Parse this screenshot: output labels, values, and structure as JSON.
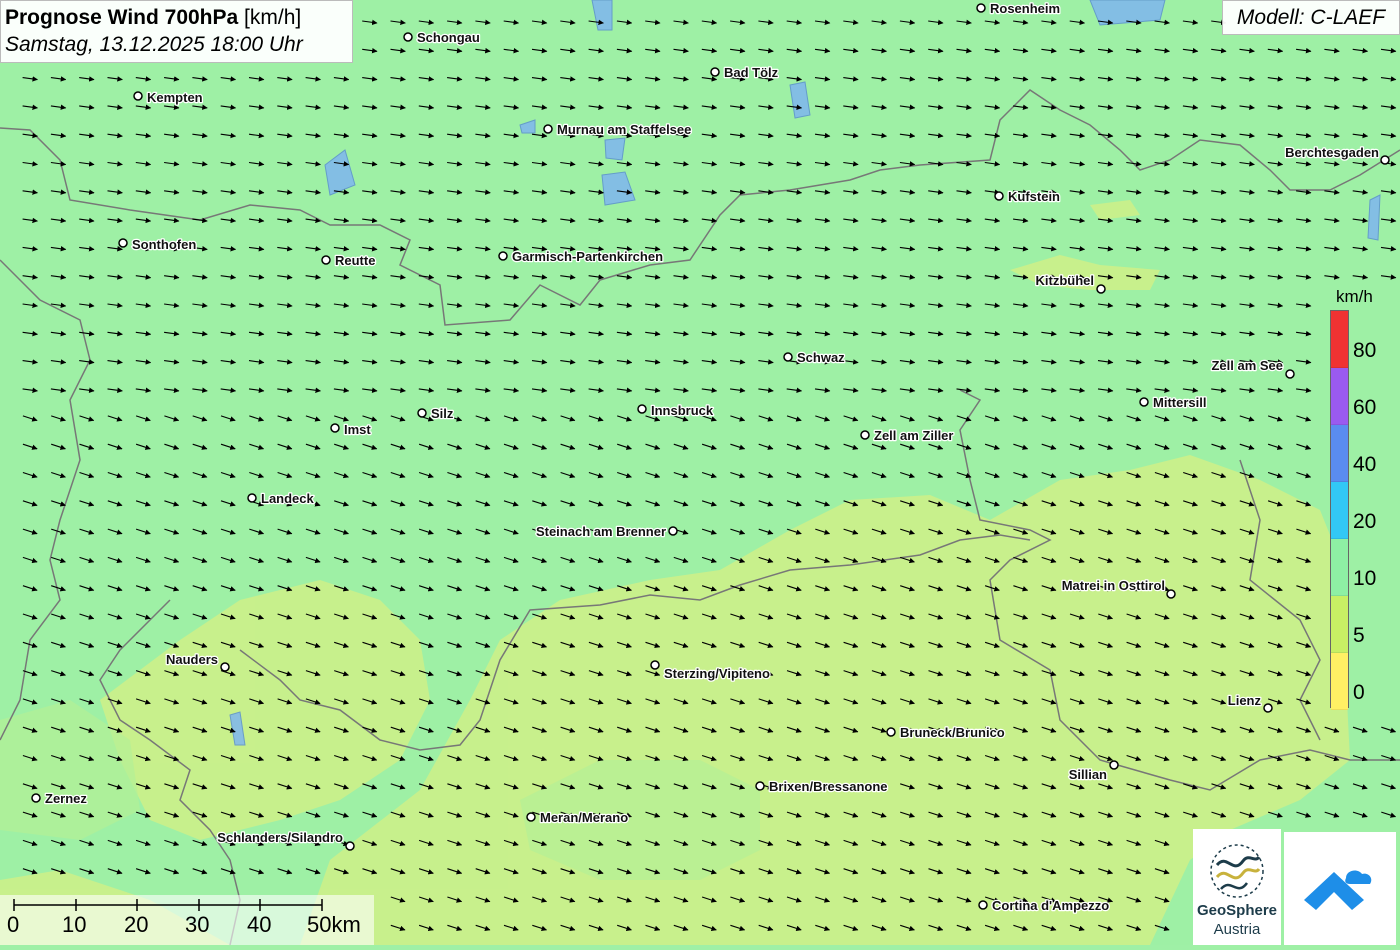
{
  "title": {
    "main": "Prognose Wind 700hPa",
    "unit": "[km/h]",
    "datetime": "Samstag, 13.12.2025 18:00 Uhr"
  },
  "model_label": "Modell: C-LAEF",
  "legend": {
    "unit": "km/h",
    "bands": [
      {
        "label": "80",
        "color": "#f03232"
      },
      {
        "label": "60",
        "color": "#9a5af0"
      },
      {
        "label": "40",
        "color": "#5a8cf0"
      },
      {
        "label": "20",
        "color": "#32c8f5"
      },
      {
        "label": "10",
        "color": "#8ef0a4"
      },
      {
        "label": "5",
        "color": "#c8f064"
      },
      {
        "label": "0",
        "color": "#fff064"
      }
    ]
  },
  "scale_bar": {
    "labels": [
      "0",
      "10",
      "20",
      "30",
      "40",
      "50km"
    ]
  },
  "logos": {
    "geosphere_line1": "GeoSphere",
    "geosphere_line2": "Austria"
  },
  "wind_direction": "northwest",
  "cities": [
    {
      "name": "Rosenheim"
    },
    {
      "name": "Schongau"
    },
    {
      "name": "Bad Tölz"
    },
    {
      "name": "Kempten"
    },
    {
      "name": "Murnau am Staffelsee"
    },
    {
      "name": "Berchtesgaden"
    },
    {
      "name": "Kufstein"
    },
    {
      "name": "Sonthofen"
    },
    {
      "name": "Reutte"
    },
    {
      "name": "Garmisch-Partenkirchen"
    },
    {
      "name": "Kitzbühel"
    },
    {
      "name": "Schwaz"
    },
    {
      "name": "Zell am See"
    },
    {
      "name": "Mittersill"
    },
    {
      "name": "Innsbruck"
    },
    {
      "name": "Silz"
    },
    {
      "name": "Imst"
    },
    {
      "name": "Zell am Ziller"
    },
    {
      "name": "Landeck"
    },
    {
      "name": "Steinach am Brenner"
    },
    {
      "name": "Matrei in Osttirol"
    },
    {
      "name": "Nauders"
    },
    {
      "name": "Sterzing/Vipiteno"
    },
    {
      "name": "Lienz"
    },
    {
      "name": "Bruneck/Brunico"
    },
    {
      "name": "Sillian"
    },
    {
      "name": "Zernez"
    },
    {
      "name": "Brixen/Bressanone"
    },
    {
      "name": "Meran/Merano"
    },
    {
      "name": "Schlanders/Silandro"
    },
    {
      "name": "Cortina d'Ampezzo"
    }
  ]
}
